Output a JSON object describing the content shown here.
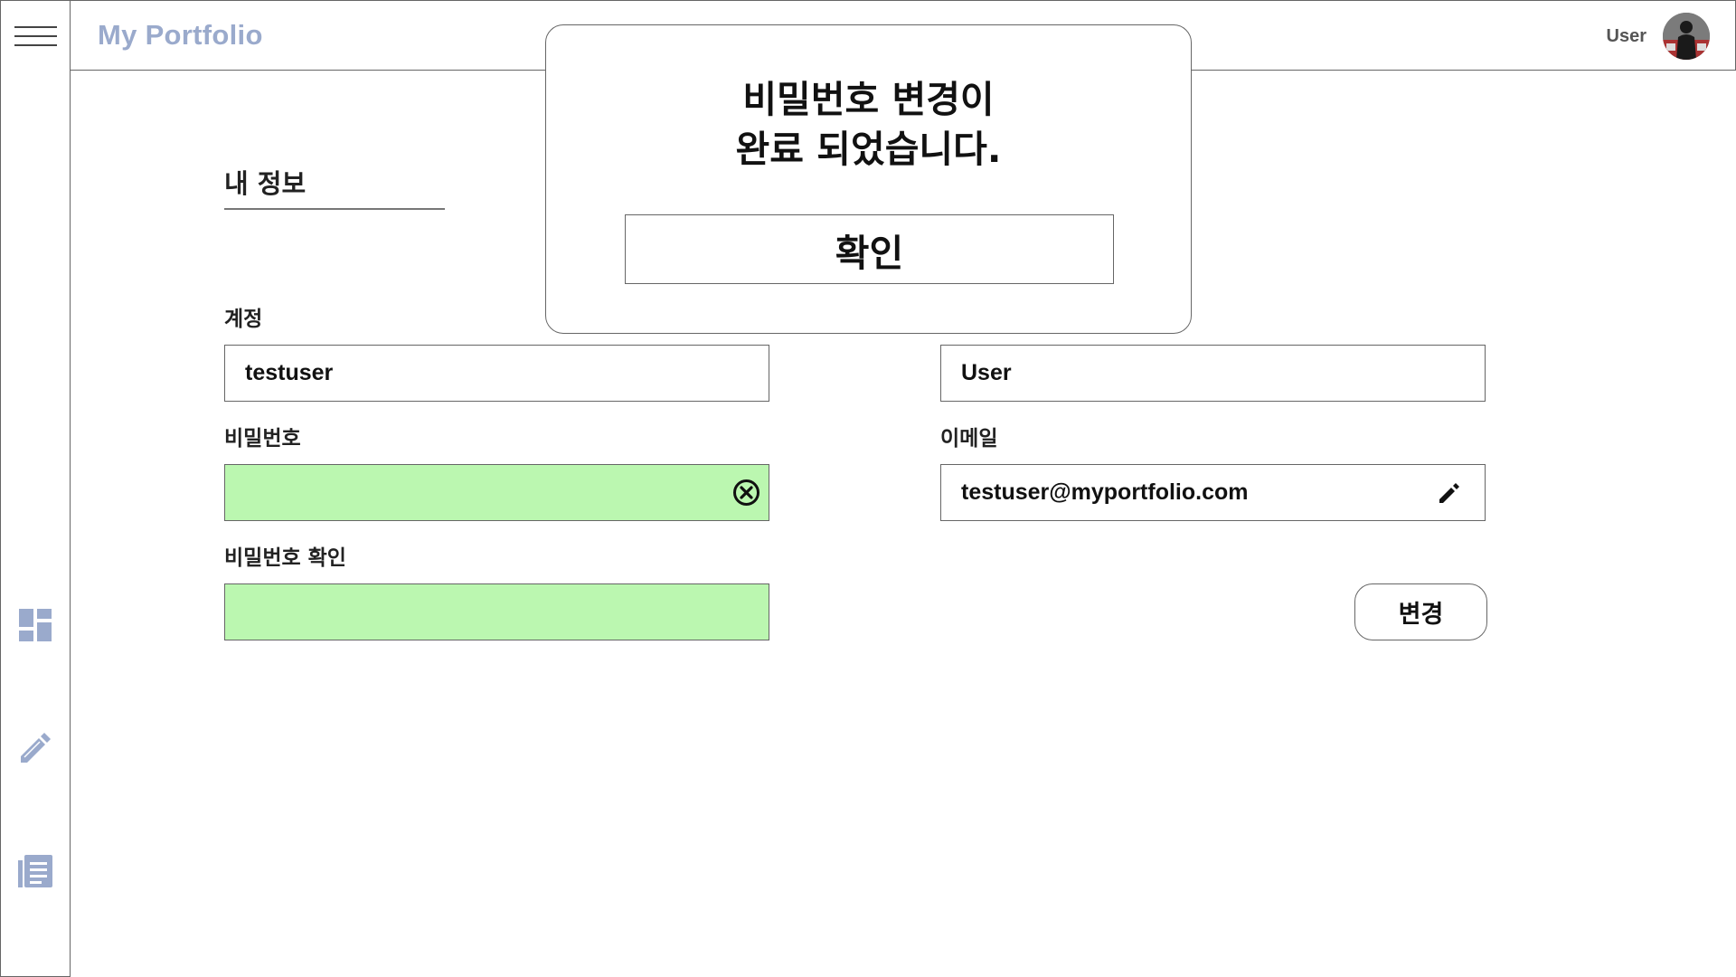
{
  "header": {
    "brand": "My Portfolio",
    "user_name": "User"
  },
  "sidebar": {
    "items": [
      {
        "icon": "menu-icon"
      },
      {
        "icon": "dashboard-icon"
      },
      {
        "icon": "pencil-icon"
      },
      {
        "icon": "article-icon"
      }
    ],
    "icon_color": "#9aaacc"
  },
  "main": {
    "section_title": "내 정보",
    "labels": {
      "account": "계정",
      "password": "비밀번호",
      "password_confirm": "비밀번호 확인",
      "email": "이메일"
    },
    "fields": {
      "account": "testuser",
      "name": "User",
      "password": "",
      "password_confirm": "",
      "email": "testuser@myportfolio.com"
    },
    "change_button": "변경",
    "valid_field_color": "#bbf7b0"
  },
  "modal": {
    "message_line1": "비밀번호 변경이",
    "message_line2": "완료 되었습니다.",
    "ok_button": "확인"
  }
}
